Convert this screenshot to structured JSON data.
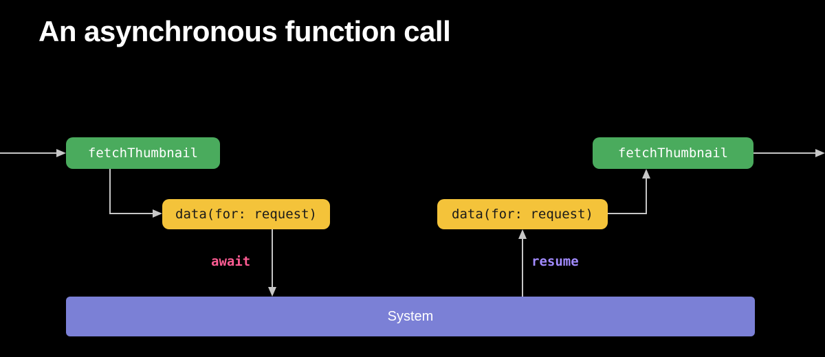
{
  "title": "An asynchronous function call",
  "boxes": {
    "fetch_left": {
      "label": "fetchThumbnail"
    },
    "fetch_right": {
      "label": "fetchThumbnail"
    },
    "data_left": {
      "label": "data(for: request)"
    },
    "data_right": {
      "label": "data(for: request)"
    },
    "system": {
      "label": "System"
    }
  },
  "labels": {
    "await": "await",
    "resume": "resume"
  },
  "colors": {
    "green": "#4aab5d",
    "yellow": "#f4c33a",
    "purple": "#7b80d6",
    "await": "#ff5c93",
    "resume": "#a28bff",
    "arrow": "#c7c7c7",
    "bg": "#000000"
  },
  "diagram_flow": [
    "enter → fetchThumbnail",
    "fetchThumbnail → data(for: request)  [await]",
    "data(for: request) → System",
    "System → data(for: request)  [resume]",
    "data(for: request) → fetchThumbnail",
    "fetchThumbnail → exit"
  ]
}
